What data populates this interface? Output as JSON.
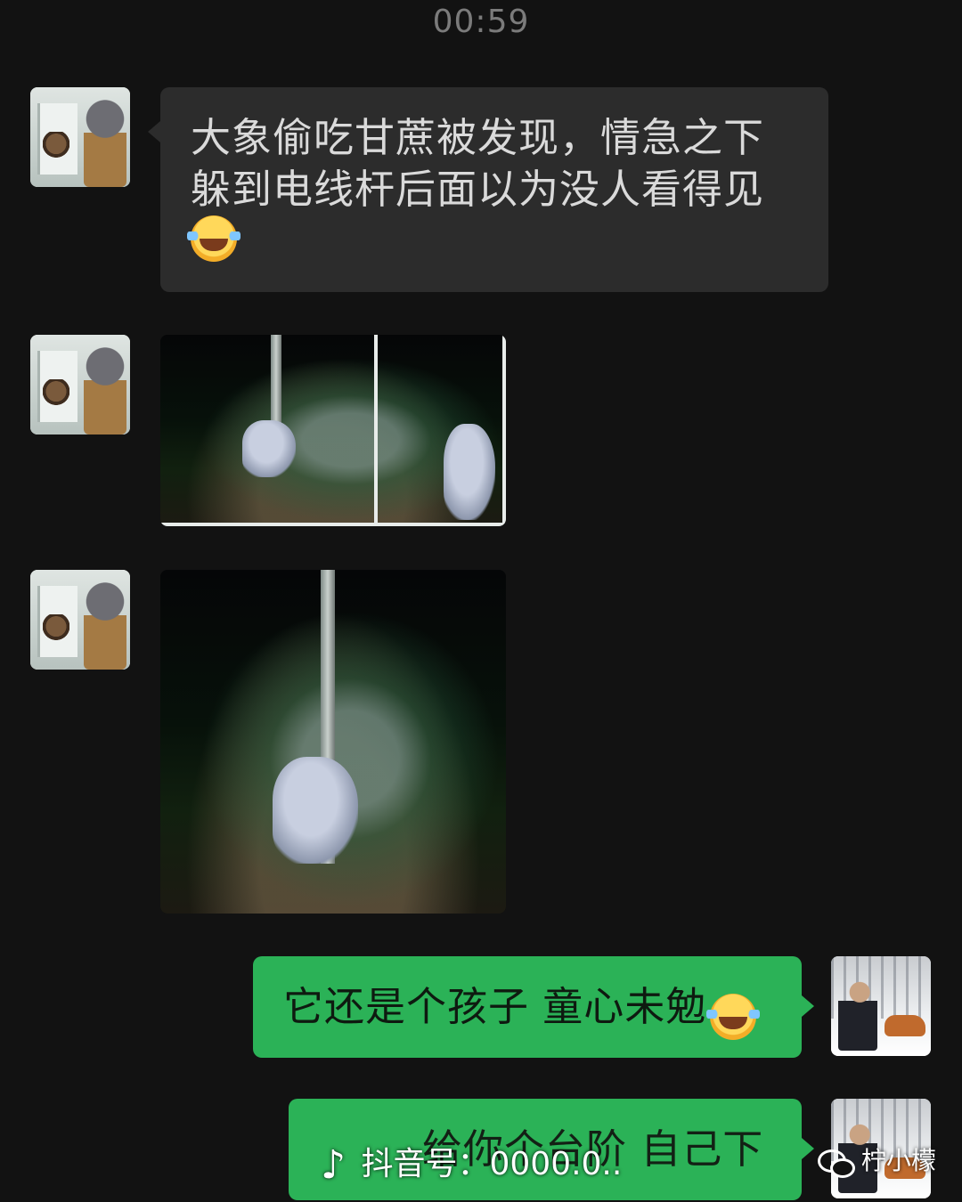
{
  "status": {
    "time": "00:59"
  },
  "messages": [
    {
      "side": "left",
      "type": "text",
      "text": "大象偷吃甘蔗被发现，情急之下躲到电线杆后面以为没人看得见",
      "emoji": "joy-emoji"
    },
    {
      "side": "left",
      "type": "image",
      "description": ""
    },
    {
      "side": "left",
      "type": "image",
      "description": ""
    },
    {
      "side": "right",
      "type": "text",
      "text": "它还是个孩子 童心未勉",
      "emoji": "joy-emoji"
    },
    {
      "side": "right",
      "type": "text",
      "text": "给你个台阶 自己下"
    }
  ],
  "watermarks": {
    "tiktok_label": "抖音号：0000.0..",
    "wechat_label": "柠小檬"
  },
  "colors": {
    "background": "#121212",
    "received_bubble": "#2c2c2c",
    "sent_bubble": "#2bb257"
  }
}
